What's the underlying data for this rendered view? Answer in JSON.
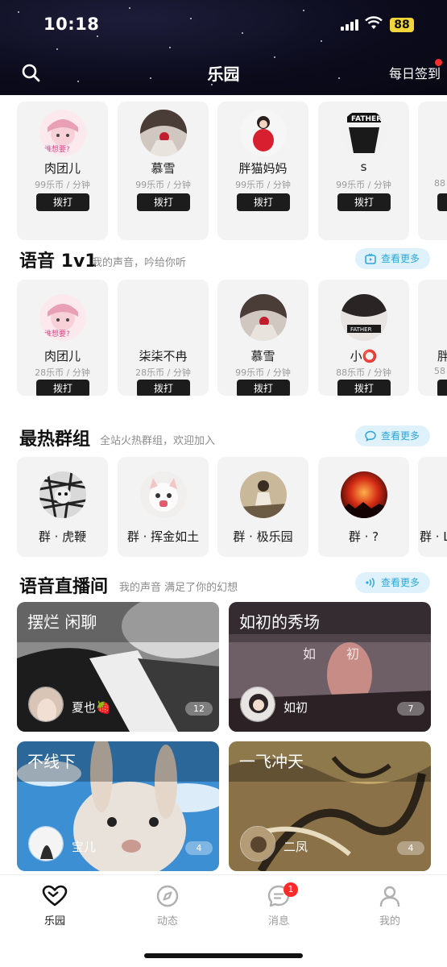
{
  "status_bar": {
    "time": "10:18",
    "battery": "88"
  },
  "header": {
    "title": "乐园",
    "checkin_label": "每日签到"
  },
  "top_row": {
    "items": [
      {
        "name": "肉团儿",
        "price": "99乐币 / 分钟",
        "call": "拨打"
      },
      {
        "name": "慕雪",
        "price": "99乐币 / 分钟",
        "call": "拨打"
      },
      {
        "name": "胖猫妈妈",
        "price": "99乐币 / 分钟",
        "call": "拨打"
      },
      {
        "name": "s",
        "price": "99乐币 / 分钟",
        "call": "拨打"
      },
      {
        "name": "",
        "price": "88",
        "call": ""
      }
    ]
  },
  "voice_1v1": {
    "title": "语音 1v1",
    "subtitle": "我的声音，吟给你听",
    "more_label": "查看更多",
    "items": [
      {
        "name": "肉团儿",
        "price": "28乐币 / 分钟",
        "call": "拨打"
      },
      {
        "name": "柒柒不冉",
        "price": "28乐币 / 分钟",
        "call": "拨打"
      },
      {
        "name": "慕雪",
        "price": "99乐币 / 分钟",
        "call": "拨打"
      },
      {
        "name": "小⭕",
        "price": "88乐币 / 分钟",
        "call": "拨打"
      },
      {
        "name": "胖",
        "price": "58",
        "call": ""
      }
    ]
  },
  "hot_groups": {
    "title": "最热群组",
    "subtitle": "全站火热群组，欢迎加入",
    "more_label": "查看更多",
    "items": [
      {
        "name": "群 · 虎鞭"
      },
      {
        "name": "群 · 挥金如土"
      },
      {
        "name": "群 · 极乐园"
      },
      {
        "name": "群 · ?"
      },
      {
        "name": "群 · L"
      }
    ]
  },
  "live_rooms": {
    "title": "语音直播间",
    "subtitle": "我的声音 满足了你的幻想",
    "more_label": "查看更多",
    "items": [
      {
        "title": "摆烂 闲聊",
        "host": "夏也🍓",
        "count": "12"
      },
      {
        "title": "如初的秀场",
        "host": "如初",
        "count": "7"
      },
      {
        "title": "不线下",
        "host": "宝儿",
        "count": "4"
      },
      {
        "title": "一飞冲天",
        "host": "二凤",
        "count": "4"
      }
    ]
  },
  "tabbar": {
    "items": [
      {
        "label": "乐园"
      },
      {
        "label": "动态"
      },
      {
        "label": "消息",
        "badge": "1"
      },
      {
        "label": "我的"
      }
    ]
  }
}
